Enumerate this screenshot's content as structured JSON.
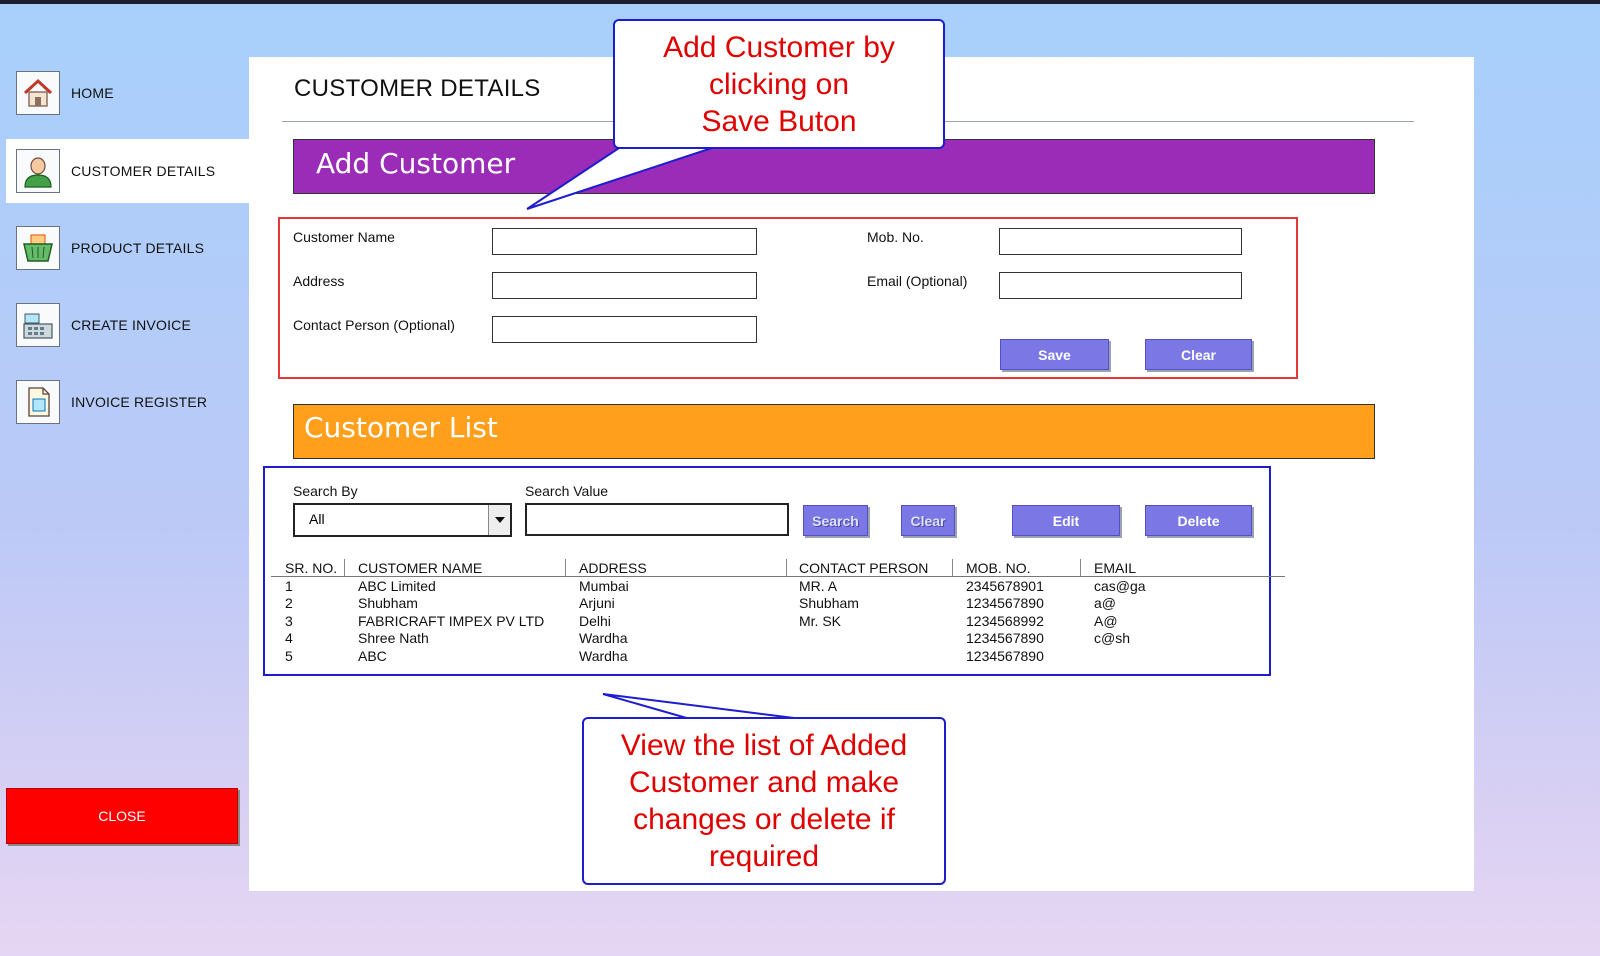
{
  "sidebar": {
    "items": [
      {
        "label": "HOME",
        "icon": "home-icon"
      },
      {
        "label": "CUSTOMER DETAILS",
        "icon": "user-icon",
        "active": true
      },
      {
        "label": "PRODUCT DETAILS",
        "icon": "basket-icon"
      },
      {
        "label": "CREATE INVOICE",
        "icon": "cash-register-icon"
      },
      {
        "label": "INVOICE REGISTER",
        "icon": "document-icon"
      }
    ],
    "close_label": "CLOSE"
  },
  "page": {
    "title": "CUSTOMER DETAILS"
  },
  "add_section": {
    "title": "Add Customer",
    "color": "#9b2cb8",
    "labels": {
      "customer_name": "Customer Name",
      "address": "Address",
      "contact_person": "Contact Person (Optional)",
      "mob_no": "Mob. No.",
      "email": "Email (Optional)"
    },
    "values": {
      "customer_name": "",
      "address": "",
      "contact_person": "",
      "mob_no": "",
      "email": ""
    },
    "save_label": "Save",
    "clear_label": "Clear"
  },
  "list_section": {
    "title": "Customer List",
    "color": "#ff9f1c",
    "search_by_label": "Search By",
    "search_by_value": "All",
    "search_value_label": "Search Value",
    "search_value": "",
    "search_label": "Search",
    "clear_label": "Clear",
    "edit_label": "Edit",
    "delete_label": "Delete",
    "columns": [
      "SR. NO.",
      "CUSTOMER NAME",
      "ADDRESS",
      "CONTACT PERSON",
      "MOB. NO.",
      "EMAIL"
    ],
    "rows": [
      [
        "1",
        "ABC Limited",
        "Mumbai",
        "MR. A",
        "2345678901",
        "cas@ga"
      ],
      [
        "2",
        "Shubham",
        "Arjuni",
        "Shubham",
        "1234567890",
        "a@"
      ],
      [
        "3",
        "FABRICRAFT IMPEX PV LTD",
        "Delhi",
        "Mr. SK",
        "1234568992",
        "A@"
      ],
      [
        "4",
        "Shree Nath",
        "Wardha",
        "",
        "1234567890",
        "c@sh"
      ],
      [
        "5",
        "ABC",
        "Wardha",
        "",
        "1234567890",
        ""
      ]
    ]
  },
  "callouts": {
    "top": "Add Customer by\nclicking on\nSave Buton",
    "bottom": "View the list of Added\nCustomer and make\nchanges or delete if\nrequired"
  },
  "accent_colors": {
    "close": "#ff0000",
    "button": "#7b78e6",
    "callout_text": "#e10000",
    "callout_border": "#1d1dcf"
  }
}
